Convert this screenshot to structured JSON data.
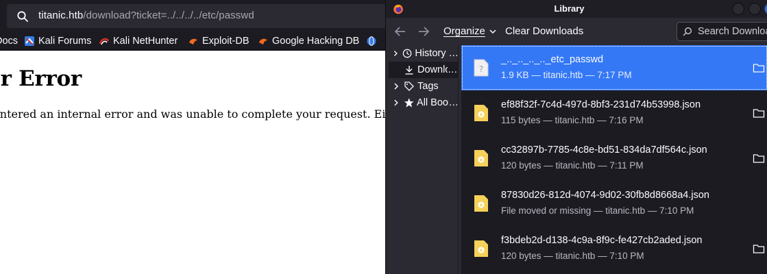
{
  "browser": {
    "url_host": "titanic.htb",
    "url_path": "/download?ticket=../../../../etc/passwd",
    "bookmarks": [
      {
        "label": "Docs",
        "icon": "docs-icon"
      },
      {
        "label": "Kali Forums",
        "icon": "kali-forums-icon"
      },
      {
        "label": "Kali NetHunter",
        "icon": "kali-nethunter-icon"
      },
      {
        "label": "Exploit-DB",
        "icon": "exploit-db-icon"
      },
      {
        "label": "Google Hacking DB",
        "icon": "google-hacking-db-icon"
      }
    ],
    "page": {
      "heading": "Internal Server Error",
      "body": "The server encountered an internal error and was unable to complete your request. Either the server is overloaded or there is an error in the application."
    }
  },
  "library": {
    "title": "Library",
    "toolbar": {
      "organize": "Organize",
      "clear_downloads": "Clear Downloads",
      "search_placeholder": "Search Downloads"
    },
    "sidebar": [
      {
        "label": "History",
        "icon": "clock-icon",
        "expandable": true
      },
      {
        "label": "Downloads",
        "icon": "download-icon",
        "expandable": false,
        "selected": true
      },
      {
        "label": "Tags",
        "icon": "tag-icon",
        "expandable": true
      },
      {
        "label": "All Bookmarks",
        "icon": "star-icon",
        "expandable": true
      }
    ],
    "downloads": [
      {
        "name": "_.._.._.._.._etc_passwd",
        "status": "1.9 KB — titanic.htb — 7:17 PM",
        "selected": true,
        "icon": "unknown-file-icon"
      },
      {
        "name": "ef88f32f-7c4d-497d-8bf3-231d74b53998.json",
        "status": "115 bytes — titanic.htb — 7:16 PM",
        "selected": false,
        "icon": "json-file-icon"
      },
      {
        "name": "cc32897b-7785-4c8e-bd51-834da7df564c.json",
        "status": "120 bytes — titanic.htb — 7:11 PM",
        "selected": false,
        "icon": "json-file-icon"
      },
      {
        "name": "87830d26-812d-4074-9d02-30fb8d8668a4.json",
        "status": "File moved or missing — titanic.htb — 7:10 PM",
        "selected": false,
        "icon": "json-file-icon"
      },
      {
        "name": "f3bdeb2d-d138-4c9a-8f9c-fe427cb2aded.json",
        "status": "120 bytes — titanic.htb — 7:10 PM",
        "selected": false,
        "icon": "json-file-icon"
      }
    ]
  },
  "colors": {
    "selection": "#3478f6",
    "window_bg": "#2b2a33",
    "list_bg": "#1c1b22",
    "json_icon": "#f5d15a"
  }
}
